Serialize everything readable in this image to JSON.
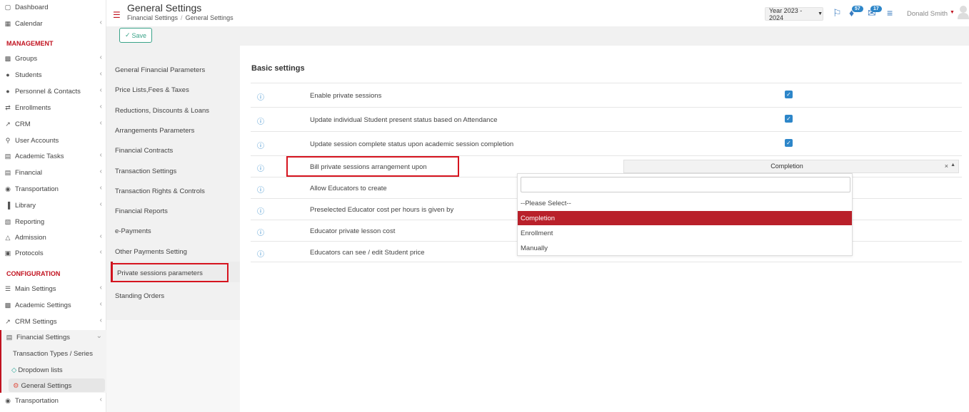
{
  "sidebar": {
    "top_items": [
      {
        "label": "Dashboard",
        "icon": "laptop-icon"
      },
      {
        "label": "Calendar",
        "icon": "calendar-icon"
      }
    ],
    "management_header": "MANAGEMENT",
    "management_items": [
      {
        "label": "Groups",
        "icon": "groups-icon"
      },
      {
        "label": "Students",
        "icon": "students-icon"
      },
      {
        "label": "Personnel & Contacts",
        "icon": "personnel-icon"
      },
      {
        "label": "Enrollments",
        "icon": "enrollments-icon"
      },
      {
        "label": "CRM",
        "icon": "crm-icon"
      },
      {
        "label": "User Accounts",
        "icon": "key-icon"
      },
      {
        "label": "Academic Tasks",
        "icon": "tasks-icon"
      },
      {
        "label": "Financial",
        "icon": "financial-icon"
      },
      {
        "label": "Transportation",
        "icon": "bus-icon"
      },
      {
        "label": "Library",
        "icon": "library-icon"
      },
      {
        "label": "Reporting",
        "icon": "printer-icon"
      },
      {
        "label": "Admission",
        "icon": "admission-icon"
      },
      {
        "label": "Protocols",
        "icon": "protocols-icon"
      }
    ],
    "configuration_header": "CONFIGURATION",
    "configuration_items": [
      {
        "label": "Main Settings",
        "icon": "sliders-icon"
      },
      {
        "label": "Academic Settings",
        "icon": "groups-icon"
      },
      {
        "label": "CRM Settings",
        "icon": "crm-icon"
      },
      {
        "label": "Financial Settings",
        "icon": "financial-icon"
      }
    ],
    "financial_sub": [
      {
        "label": "Transaction Types / Series"
      },
      {
        "label": "Dropdown lists",
        "icon": "layers-icon"
      },
      {
        "label": "General Settings",
        "icon": "gear-icon"
      }
    ],
    "bottom_item": {
      "label": "Transportation",
      "icon": "bus-icon"
    }
  },
  "header": {
    "title": "General Settings",
    "breadcrumb": [
      "Financial Settings",
      "General Settings"
    ],
    "year_select": "Year 2023 - 2024",
    "notif_count": "57",
    "mail_count": "17",
    "user_name": "Donald Smith"
  },
  "toolbar": {
    "save_label": "Save"
  },
  "left_nav": [
    "General Financial Parameters",
    "Price Lists,Fees & Taxes",
    "Reductions, Discounts & Loans",
    "Arrangements Parameters",
    "Financial Contracts",
    "Transaction Settings",
    "Transaction Rights & Controls",
    "Financial Reports",
    "e-Payments",
    "Other Payments Setting",
    "Private sessions parameters",
    "Standing Orders"
  ],
  "basic_settings": {
    "title": "Basic settings",
    "rows": [
      {
        "label": "Enable private sessions",
        "checked": true
      },
      {
        "label": "Update individual Student present status based on Attendance",
        "checked": true
      },
      {
        "label": "Update session complete status upon academic session completion",
        "checked": true
      },
      {
        "label": "Bill private sessions arrangement upon",
        "select_value": "Completion"
      },
      {
        "label": "Allow Educators to create"
      },
      {
        "label": "Preselected Educator cost per hours is given by"
      },
      {
        "label": "Educator private lesson cost"
      },
      {
        "label": "Educators can see / edit Student price"
      }
    ]
  },
  "dropdown": {
    "search_value": "",
    "options": [
      "--Please Select--",
      "Completion",
      "Enrollment",
      "Manually"
    ],
    "selected": "Completion"
  },
  "colors": {
    "accent": "#c1121f",
    "primary": "#2d86c9",
    "save": "#3aa389"
  }
}
